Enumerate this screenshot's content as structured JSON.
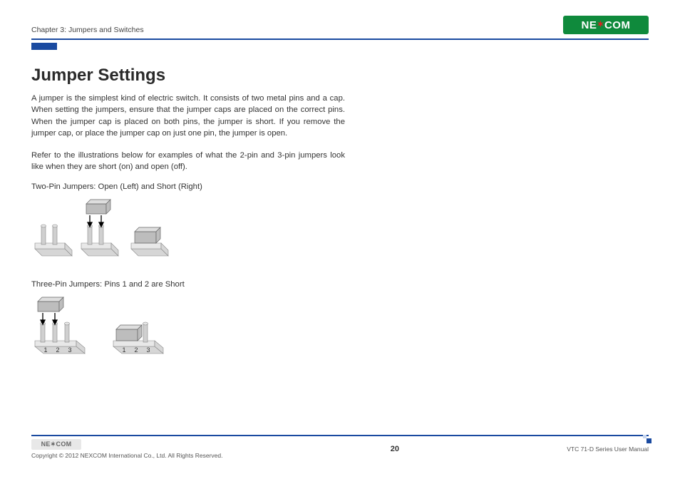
{
  "header": {
    "chapter_label": "Chapter 3: Jumpers and Switches",
    "logo_text_left": "NE",
    "logo_text_right": "COM",
    "logo_star": "✶"
  },
  "title": "Jumper Settings",
  "paragraphs": {
    "p1": "A jumper is the simplest kind of electric switch. It consists of two metal pins and a cap. When setting the jumpers, ensure that the jumper caps are placed on the correct pins. When the jumper cap is placed on both pins, the jumper is short. If you remove the jumper cap, or place the jumper cap on just one pin, the jumper is open.",
    "p2": "Refer to the illustrations below for examples of what the 2-pin and 3-pin jumpers look like when they are short (on) and open (off)."
  },
  "captions": {
    "two_pin": "Two-Pin Jumpers: Open (Left) and Short (Right)",
    "three_pin": "Three-Pin Jumpers: Pins 1 and 2 are Short"
  },
  "pin_labels": {
    "1": "1",
    "2": "2",
    "3": "3"
  },
  "footer": {
    "logo_text": "NE✶COM",
    "copyright": "Copyright © 2012 NEXCOM International Co., Ltd. All Rights Reserved.",
    "page_number": "20",
    "manual_name": "VTC 71-D Series User Manual"
  }
}
